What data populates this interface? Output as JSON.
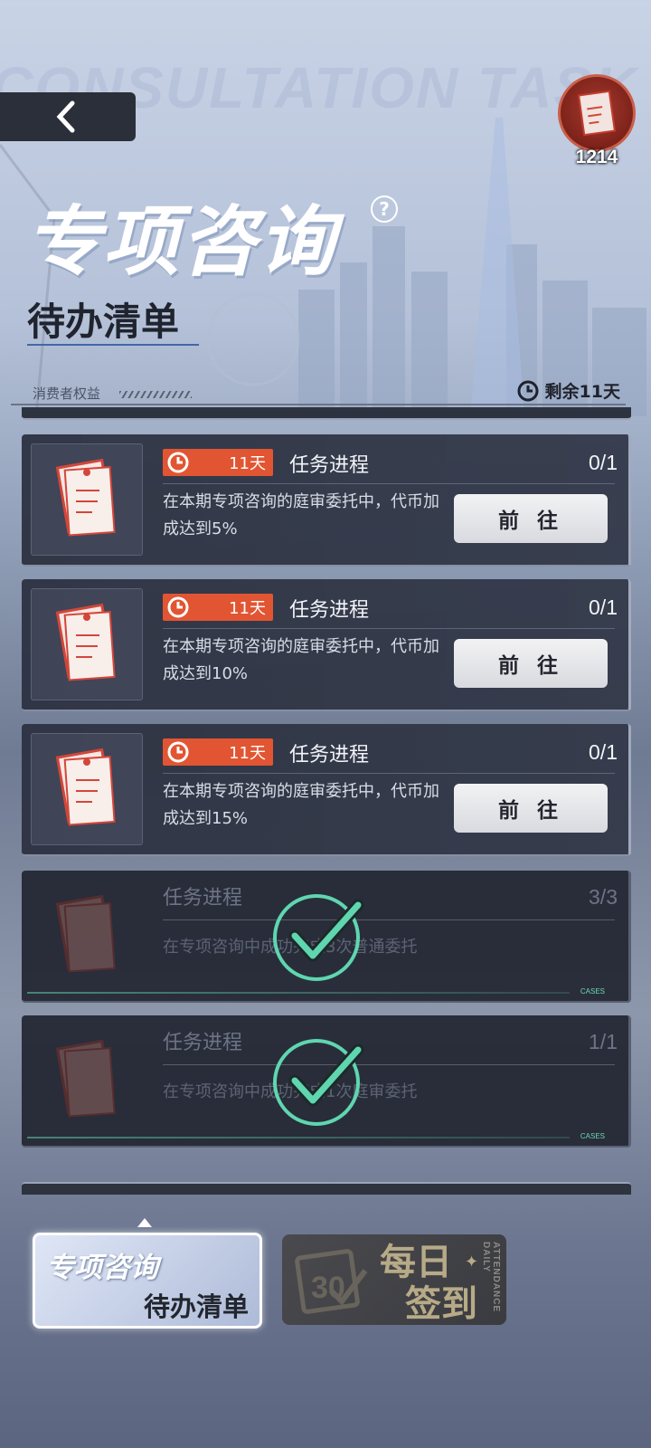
{
  "header": {
    "watermark": "CONSULTATION TASK LIST",
    "title": "专项咨询",
    "subtitle": "待办清单",
    "help_symbol": "?",
    "section_label": "消费者权益",
    "remaining": "剩余11天"
  },
  "currency": {
    "count": "1214",
    "icon": "case-file-icon"
  },
  "tasks": [
    {
      "days": "11天",
      "title": "任务进程",
      "progress": "0/1",
      "desc": "在本期专项咨询的庭审委托中，代币加成达到5%",
      "button": "前 往"
    },
    {
      "days": "11天",
      "title": "任务进程",
      "progress": "0/1",
      "desc": "在本期专项咨询的庭审委托中，代币加成达到10%",
      "button": "前 往"
    },
    {
      "days": "11天",
      "title": "任务进程",
      "progress": "0/1",
      "desc": "在本期专项咨询的庭审委托中，代币加成达到15%",
      "button": "前 往"
    }
  ],
  "done_tasks": [
    {
      "title": "任务进程",
      "progress": "3/3",
      "desc": "在专项咨询中成功完成3次普通委托",
      "tag": "CASES"
    },
    {
      "title": "任务进程",
      "progress": "1/1",
      "desc": "在专项咨询中成功完成1次庭审委托",
      "tag": "CASES"
    }
  ],
  "tabs": {
    "active_line1": "专项咨询",
    "active_line2": "待办清单",
    "inactive_text": "每日\n签到",
    "inactive_vertical": "ATTENDANCE DAILY"
  },
  "colors": {
    "accent_red": "#e25532",
    "check_green": "#5fd6b0",
    "card_bg": "#2e3342"
  }
}
